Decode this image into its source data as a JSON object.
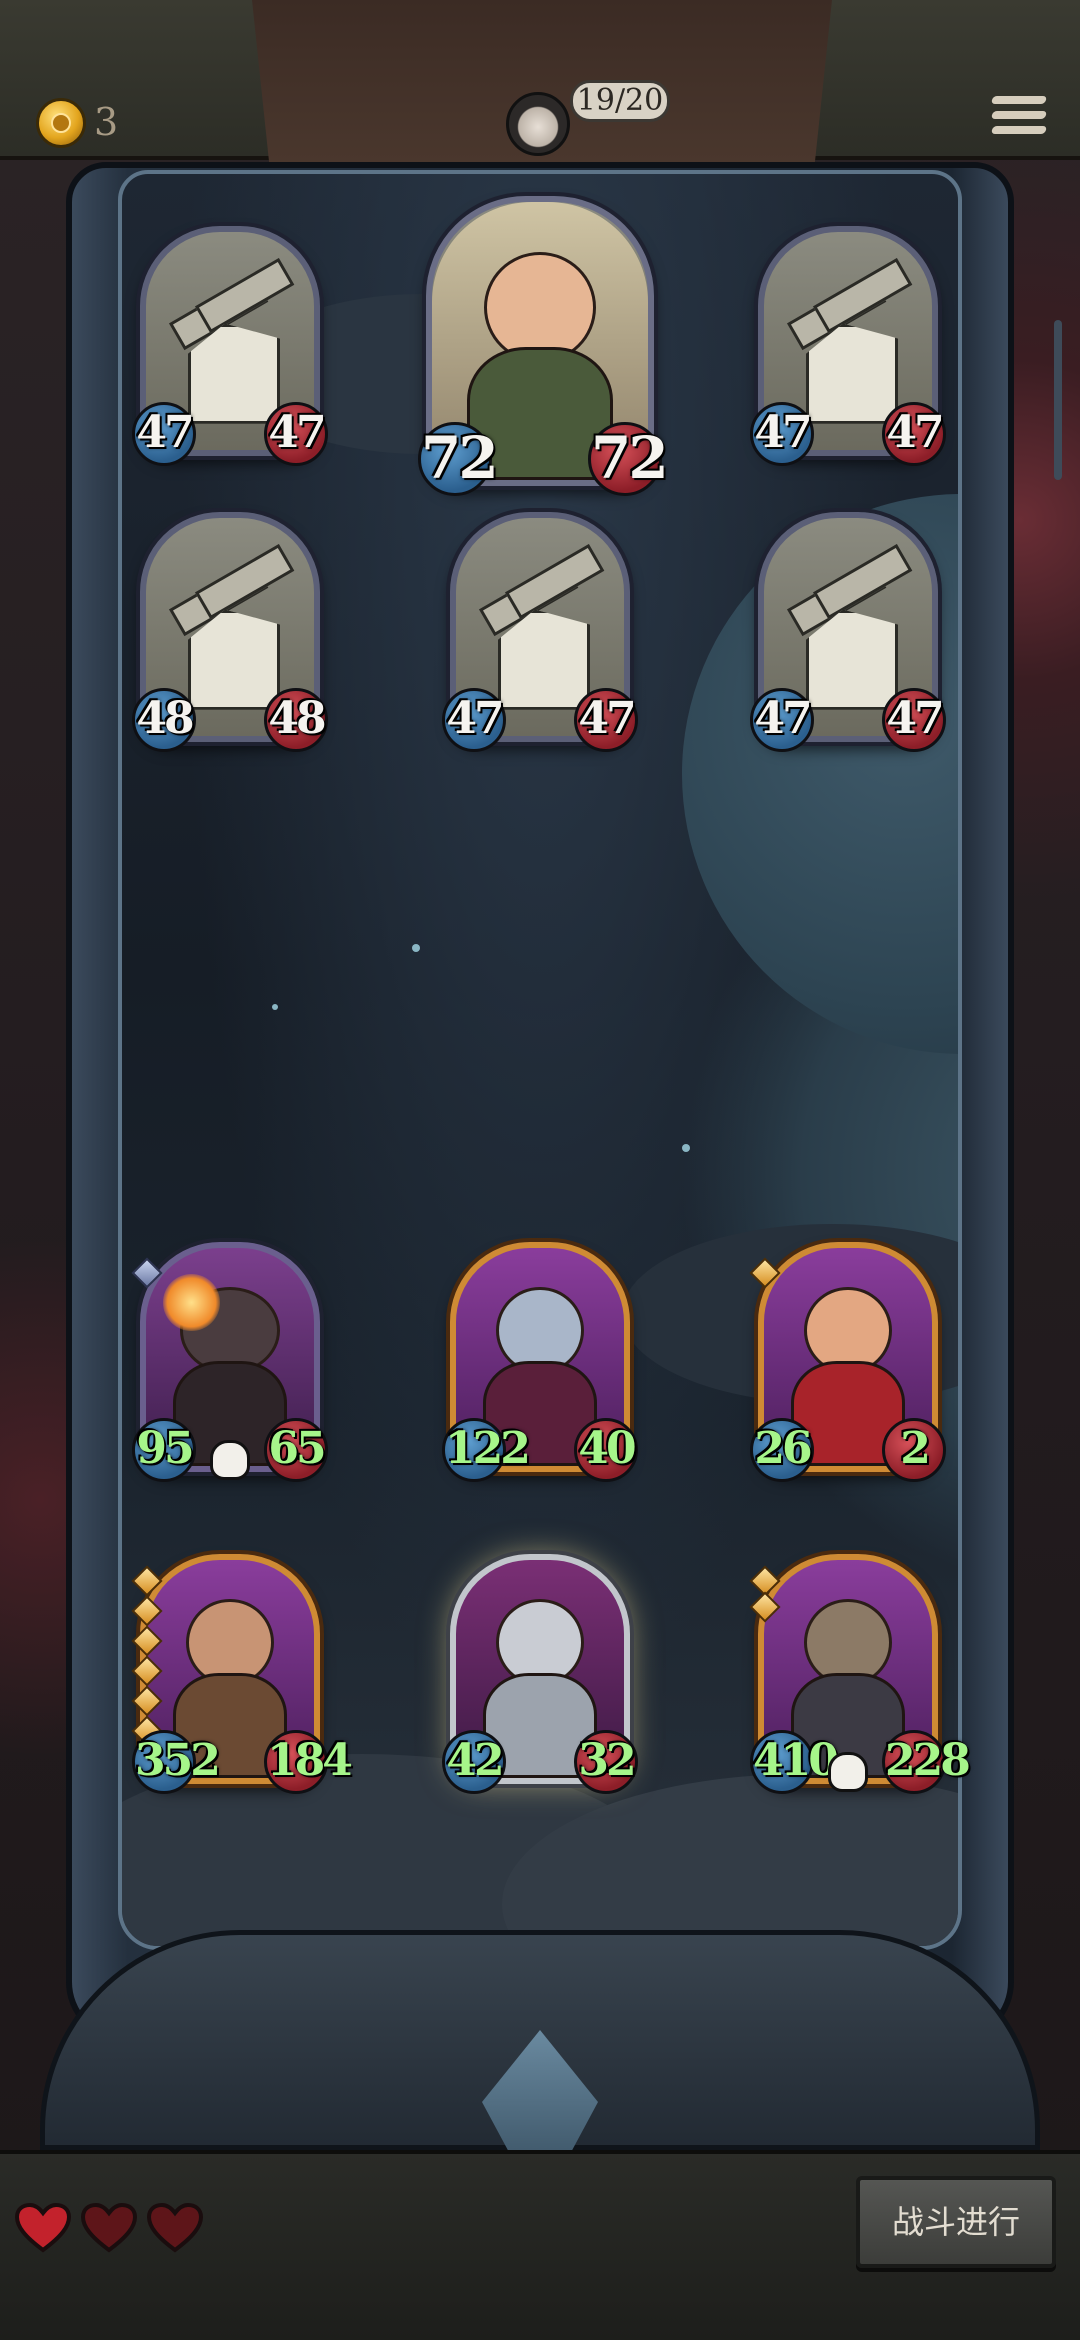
{
  "hud": {
    "coins": "3",
    "turn": "19/20",
    "icons": {
      "coin": "crown-coin-icon",
      "menu": "hamburger-menu-icon",
      "avatar": "player-avatar-icon"
    }
  },
  "enemy_board": [
    {
      "name": "turret",
      "attack": "47",
      "health": "47"
    },
    {
      "name": "archer",
      "attack": "72",
      "health": "72"
    },
    {
      "name": "turret",
      "attack": "47",
      "health": "47"
    },
    {
      "name": "turret",
      "attack": "48",
      "health": "48"
    },
    {
      "name": "turret",
      "attack": "47",
      "health": "47"
    },
    {
      "name": "turret",
      "attack": "47",
      "health": "47"
    }
  ],
  "player_board": [
    {
      "name": "flame-beast",
      "attack": "95",
      "health": "65",
      "skull": true
    },
    {
      "name": "elf-sorceress",
      "attack": "122",
      "health": "40"
    },
    {
      "name": "dwarf-warrior",
      "attack": "26",
      "health": "2"
    },
    {
      "name": "barbarian",
      "attack": "352",
      "health": "184"
    },
    {
      "name": "knight",
      "attack": "42",
      "health": "32"
    },
    {
      "name": "scarecrow",
      "attack": "410",
      "health": "228",
      "skull": true
    }
  ],
  "lives": {
    "total": 3,
    "icon": "heart-icon"
  },
  "actions": {
    "battle": "战斗进行"
  },
  "colors": {
    "attack": "#2b5f8e",
    "health": "#8d1e28",
    "enemy_stat_text": "#f5f3ef",
    "ally_stat_text": "#a6f58a",
    "hero_frame": "#cf8b34"
  }
}
